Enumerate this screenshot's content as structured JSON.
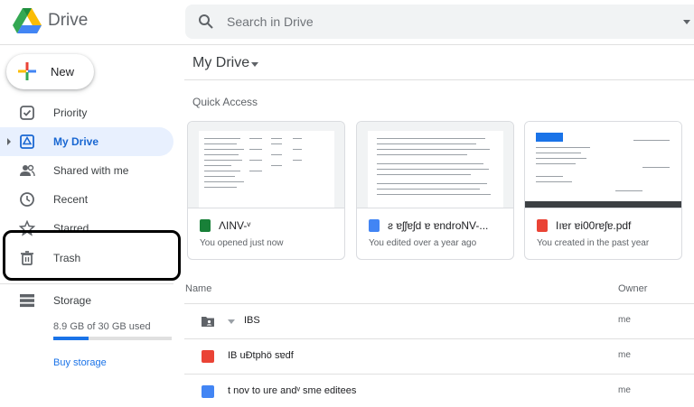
{
  "app": {
    "title": "Drive"
  },
  "search": {
    "placeholder": "Search in Drive"
  },
  "sidebar": {
    "new_label": "New",
    "items": [
      {
        "label": "Priority",
        "icon": "check-square-icon"
      },
      {
        "label": "My Drive",
        "icon": "drive-icon",
        "active": true
      },
      {
        "label": "Shared with me",
        "icon": "people-icon"
      },
      {
        "label": "Recent",
        "icon": "clock-icon"
      },
      {
        "label": "Starred",
        "icon": "star-icon"
      },
      {
        "label": "Trash",
        "icon": "trash-icon"
      },
      {
        "label": "Storage",
        "icon": "storage-icon"
      }
    ],
    "storage_used": "8.9 GB of 30 GB used",
    "storage_fraction": 0.297,
    "buy_storage": "Buy storage"
  },
  "main": {
    "title": "My Drive",
    "quick_access_label": "Quick Access",
    "cards": [
      {
        "name": "ɅINV-ᵛ",
        "subtitle": "You opened just now",
        "type": "sheets",
        "icon_color": "#188038"
      },
      {
        "name": "ƨ ɐʃʃɐʃd ɐ ɐndroNV-...",
        "subtitle": "You edited over a year ago",
        "type": "docs",
        "icon_color": "#4285f4"
      },
      {
        "name": "Iıɐr ɐi00rɐʃɐ.pdf",
        "subtitle": "You created in the past year",
        "type": "pdf",
        "icon_color": "#ea4335"
      }
    ],
    "columns": {
      "name": "Name",
      "owner": "Owner"
    },
    "rows": [
      {
        "name": "IBS",
        "owner": "me",
        "type": "folder",
        "icon_color": "#5f6368"
      },
      {
        "name": "IB uÐtphö   sɐdf",
        "owner": "me",
        "type": "pdf",
        "icon_color": "#ea4335"
      },
      {
        "name": "t nov to   ure andᵛ   sme  editees",
        "owner": "me",
        "type": "docs",
        "icon_color": "#4285f4"
      }
    ]
  },
  "colors": {
    "accent": "#1a73e8",
    "active_bg": "#e8f0fe",
    "active_text": "#1967d2"
  }
}
